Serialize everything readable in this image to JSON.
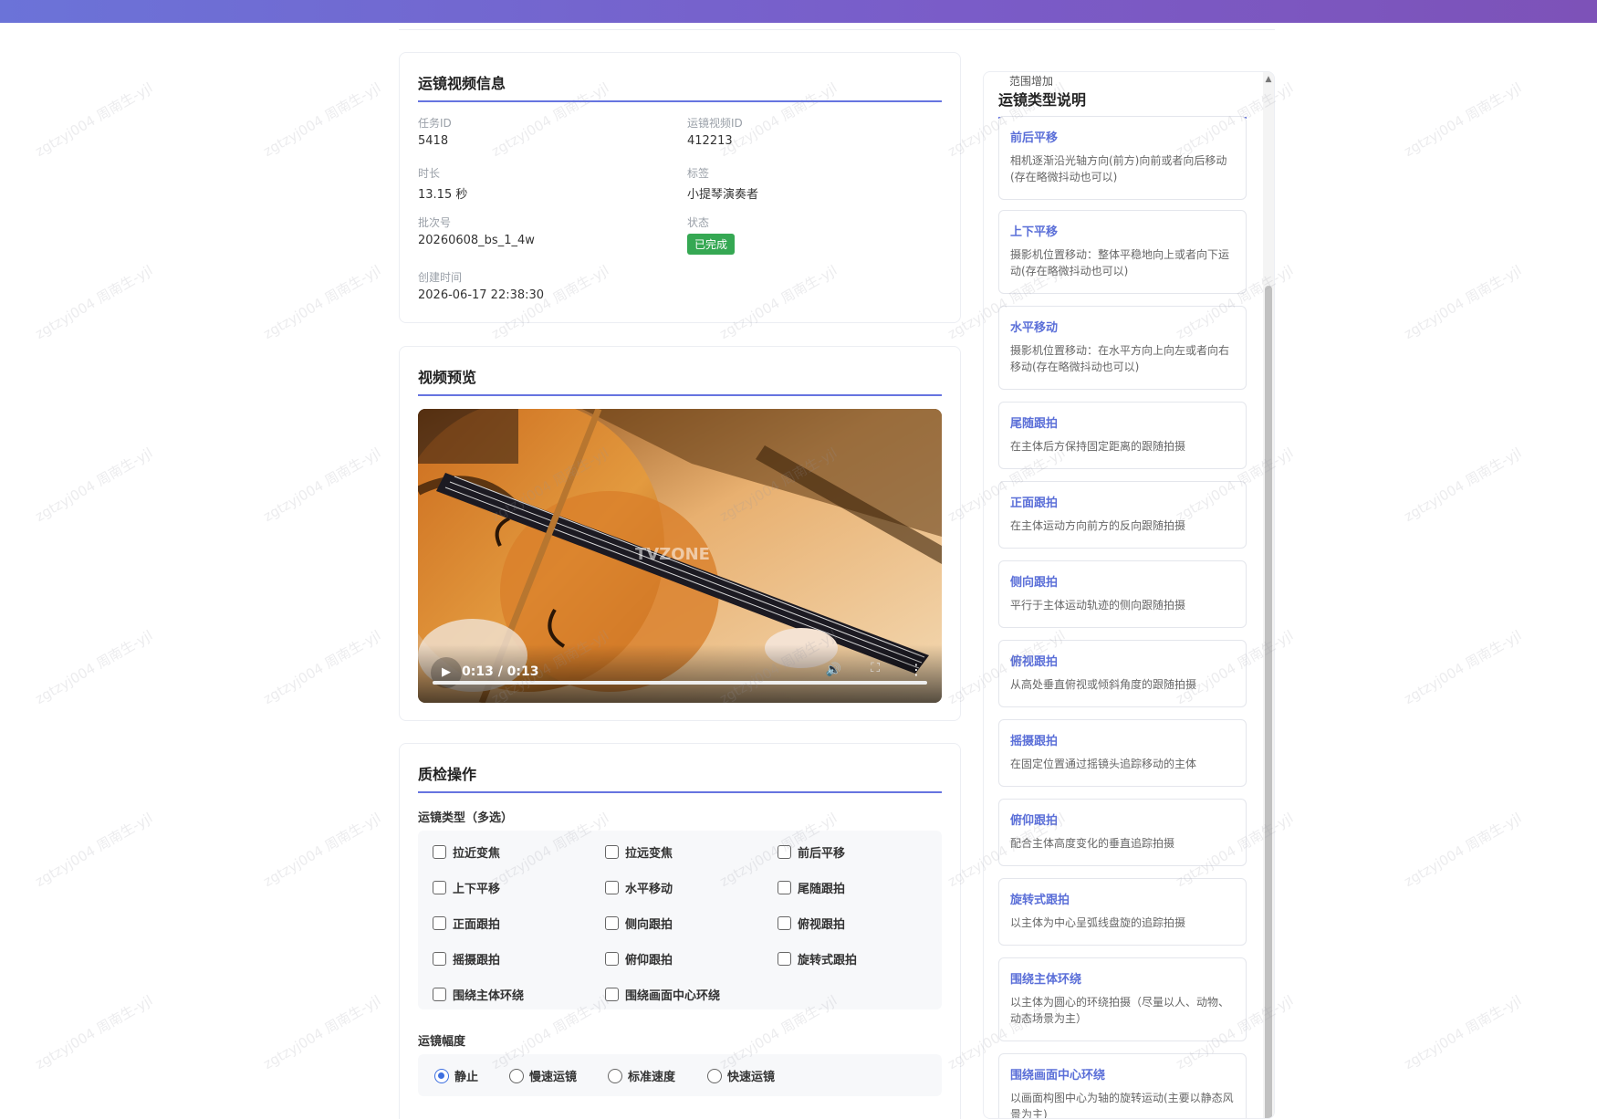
{
  "info": {
    "title": "运镜视频信息",
    "task_id_label": "任务ID",
    "task_id": "5418",
    "video_id_label": "运镜视频ID",
    "video_id": "412213",
    "duration_label": "时长",
    "duration": "13.15 秒",
    "tag_label": "标签",
    "tag": "小提琴演奏者",
    "batch_label": "批次号",
    "batch": "20260608_bs_1_4w",
    "status_label": "状态",
    "status": "已完成",
    "created_label": "创建时间",
    "created": "2026-06-17 22:38:30"
  },
  "preview": {
    "title": "视频预览",
    "time": "0:13 / 0:13",
    "watermark_text": "TVZONE"
  },
  "qc": {
    "title": "质检操作",
    "type_label": "运镜类型（多选）",
    "types": [
      "拉近变焦",
      "拉远变焦",
      "前后平移",
      "上下平移",
      "水平移动",
      "尾随跟拍",
      "正面跟拍",
      "侧向跟拍",
      "俯视跟拍",
      "摇摄跟拍",
      "俯仰跟拍",
      "旋转式跟拍",
      "围绕主体环绕",
      "围绕画面中心环绕"
    ],
    "amplitude_label": "运镜幅度",
    "amplitudes": [
      "静止",
      "慢速运镜",
      "标准速度",
      "快速运镜"
    ],
    "selected_amplitude": "静止"
  },
  "sidebar": {
    "clipped_text": "范围增加",
    "title": "运镜类型说明",
    "items": [
      {
        "name": "前后平移",
        "desc": "相机逐渐沿光轴方向(前方)向前或者向后移动(存在略微抖动也可以)"
      },
      {
        "name": "上下平移",
        "desc": "摄影机位置移动：整体平稳地向上或者向下运动(存在略微抖动也可以)"
      },
      {
        "name": "水平移动",
        "desc": "摄影机位置移动：在水平方向上向左或者向右移动(存在略微抖动也可以)"
      },
      {
        "name": "尾随跟拍",
        "desc": "在主体后方保持固定距离的跟随拍摄"
      },
      {
        "name": "正面跟拍",
        "desc": "在主体运动方向前方的反向跟随拍摄"
      },
      {
        "name": "侧向跟拍",
        "desc": "平行于主体运动轨迹的侧向跟随拍摄"
      },
      {
        "name": "俯视跟拍",
        "desc": "从高处垂直俯视或倾斜角度的跟随拍摄"
      },
      {
        "name": "摇摄跟拍",
        "desc": "在固定位置通过摇镜头追踪移动的主体"
      },
      {
        "name": "俯仰跟拍",
        "desc": "配合主体高度变化的垂直追踪拍摄"
      },
      {
        "name": "旋转式跟拍",
        "desc": "以主体为中心呈弧线盘旋的追踪拍摄"
      },
      {
        "name": "围绕主体环绕",
        "desc": "以主体为圆心的环绕拍摄（尽量以人、动物、动态场景为主）"
      },
      {
        "name": "围绕画面中心环绕",
        "desc": "以画面构图中心为轴的旋转运动(主要以静态风景为主)"
      }
    ]
  },
  "watermark": "zgtzyj004 周南生-yjl"
}
